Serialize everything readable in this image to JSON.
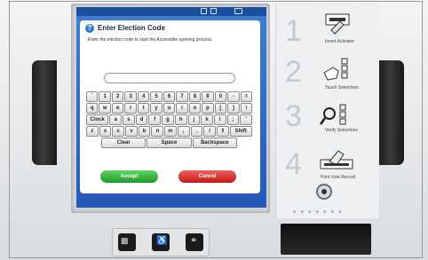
{
  "screen": {
    "taskbar_time": "",
    "dialog": {
      "title": "Enter Election Code",
      "instruction": "Enter the election code to start the Accessible opening process.",
      "code_field_value": "",
      "keyboard": {
        "row1": [
          "`",
          "1",
          "2",
          "3",
          "4",
          "5",
          "6",
          "7",
          "8",
          "9",
          "0",
          "-",
          "="
        ],
        "row2": [
          "q",
          "w",
          "e",
          "r",
          "t",
          "y",
          "u",
          "i",
          "o",
          "p",
          "[",
          "]",
          "\\"
        ],
        "row3": [
          "Clock",
          "a",
          "s",
          "d",
          "f",
          "g",
          "h",
          "j",
          "k",
          "l",
          ";",
          "'"
        ],
        "row4": [
          "z",
          "x",
          "c",
          "v",
          "b",
          "n",
          "m",
          ",",
          ".",
          "/",
          "⇧",
          "Shift"
        ],
        "row5": [
          "Clear",
          "Space",
          "Backspace"
        ]
      },
      "accept_label": "Accept",
      "cancel_label": "Cancel"
    }
  },
  "steps": [
    {
      "number": "1",
      "label": "Insert Activator",
      "icon": "activator-card-icon"
    },
    {
      "number": "2",
      "label": "Touch Selections",
      "icon": "touch-hand-icon"
    },
    {
      "number": "3",
      "label": "Verify Selections",
      "icon": "magnifier-icon"
    },
    {
      "number": "4",
      "label": "Print Vote Record",
      "icon": "print-record-icon"
    }
  ],
  "dashes": "▾▾▾▾▾▾▾",
  "colors": {
    "screen_blue": "#2e6fca",
    "accept_green": "#1e9a2a",
    "cancel_red": "#c41818"
  }
}
